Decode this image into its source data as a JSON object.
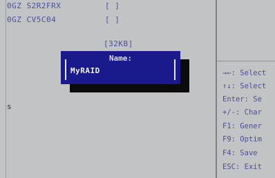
{
  "drives": [
    {
      "name": "0GZ S2R2FRX",
      "checkbox": "[ ]"
    },
    {
      "name": "0GZ CV5C04",
      "checkbox": "[ ]"
    }
  ],
  "raid_size": "[32KB]",
  "left_marker": "s",
  "dialog": {
    "title": "Name:",
    "value": "MyRAID"
  },
  "help": [
    {
      "keys": "→←:",
      "text": "Select"
    },
    {
      "keys": "↑↓:",
      "text": "Select"
    },
    {
      "keys": "Enter:",
      "text": "Se"
    },
    {
      "keys": "+/-:",
      "text": "Char"
    },
    {
      "keys": "F1:",
      "text": "Gener"
    },
    {
      "keys": "F9:",
      "text": "Optim"
    },
    {
      "keys": "F4:",
      "text": "Save"
    },
    {
      "keys": "ESC:",
      "text": "Exit"
    }
  ]
}
